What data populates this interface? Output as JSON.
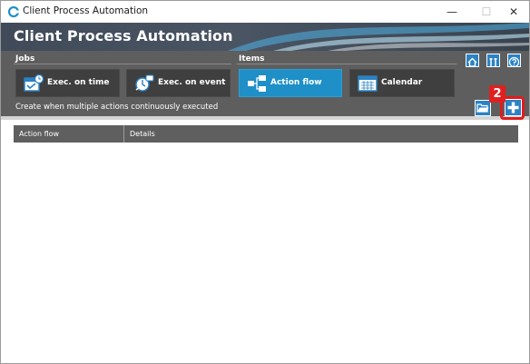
{
  "window": {
    "title": "Client Process Automation",
    "minimize_glyph": "—",
    "maximize_glyph": "☐",
    "close_glyph": "✕"
  },
  "banner": {
    "title": "Client Process Automation"
  },
  "toolbar": {
    "jobs_label": "Jobs",
    "items_label": "Items",
    "buttons": [
      {
        "label": "Exec. on time",
        "icon": "calendar-clock-icon",
        "active": false
      },
      {
        "label": "Exec. on event",
        "icon": "gear-clock-icon",
        "active": false
      },
      {
        "label": "Action flow",
        "icon": "flow-icon",
        "active": true
      },
      {
        "label": "Calendar",
        "icon": "calendar-icon",
        "active": false
      }
    ],
    "hint": "Create when multiple actions continuously executed",
    "top_right_icons": [
      "home-icon",
      "tools-icon",
      "help-icon"
    ],
    "action_icons": [
      "open-folder-icon",
      "add-icon"
    ]
  },
  "table": {
    "columns": [
      "Action flow",
      "Details"
    ],
    "rows": []
  },
  "callout": {
    "number": "2",
    "color": "#e02020"
  },
  "colors": {
    "accent": "#1e8fc7",
    "toolbar_bg": "#5e5e5e",
    "banner_bg": "#444e5c"
  }
}
